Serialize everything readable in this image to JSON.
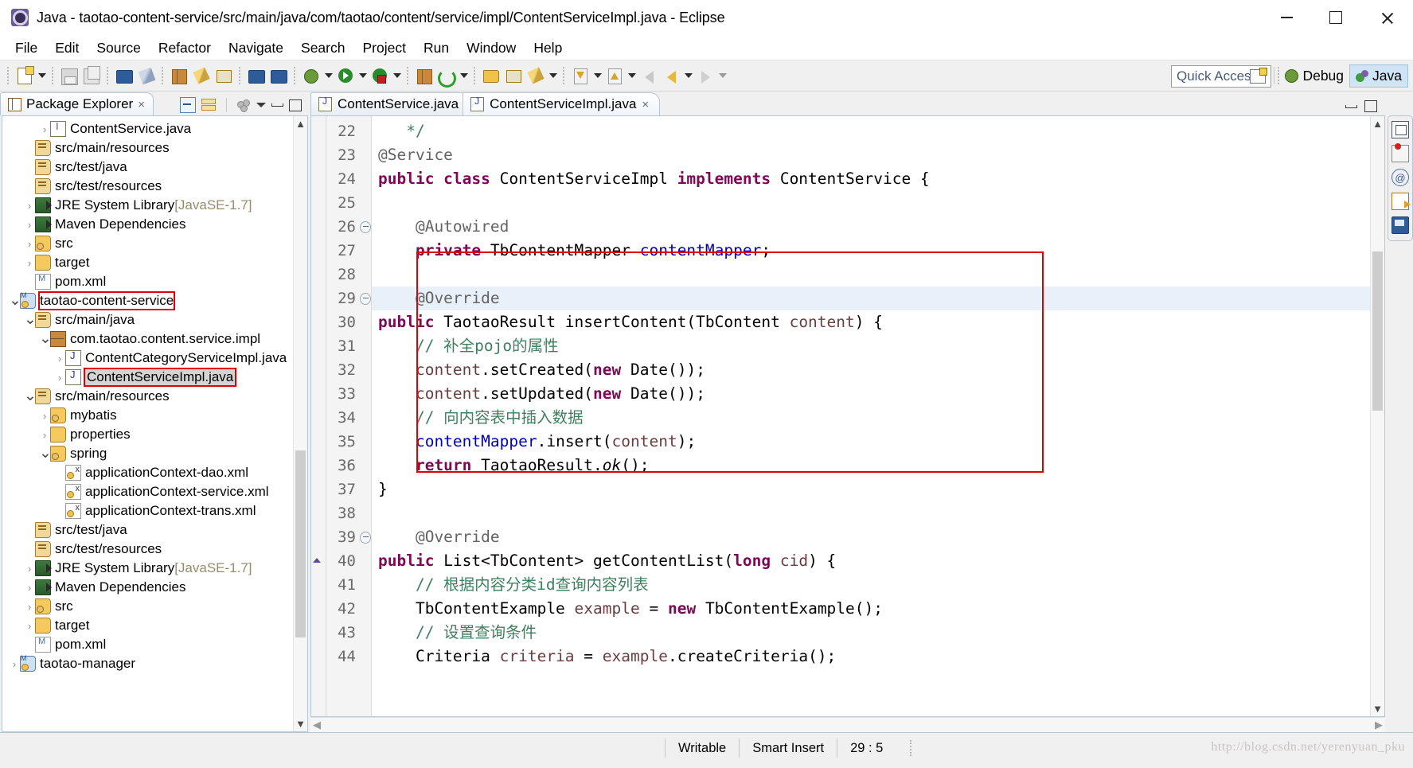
{
  "window": {
    "title": "Java - taotao-content-service/src/main/java/com/taotao/content/service/impl/ContentServiceImpl.java - Eclipse",
    "app_icon": "eclipse-icon",
    "controls": {
      "minimize": "minimize-button",
      "maximize": "maximize-button",
      "close": "close-button"
    }
  },
  "menubar": {
    "items": [
      "File",
      "Edit",
      "Source",
      "Refactor",
      "Navigate",
      "Search",
      "Project",
      "Run",
      "Window",
      "Help"
    ]
  },
  "toolbar": {
    "quick_access_placeholder": "Quick Access",
    "perspectives": [
      {
        "label": "Debug",
        "icon": "debug-perspective-icon",
        "active": false
      },
      {
        "label": "Java",
        "icon": "java-perspective-icon",
        "active": true
      }
    ],
    "open_perspective_icon": "open-perspective-icon"
  },
  "package_explorer": {
    "title": "Package Explorer",
    "tab_close": "×",
    "tools": [
      "collapse-all-icon",
      "link-with-editor-icon",
      "view-menu-icon",
      "minimize-icon",
      "maximize-icon"
    ],
    "tree": [
      {
        "indent": 2,
        "arrow": "closed",
        "icon": "java-interface-icon",
        "label": "ContentService.java"
      },
      {
        "indent": 1,
        "arrow": "none",
        "icon": "source-folder-icon",
        "label": "src/main/resources"
      },
      {
        "indent": 1,
        "arrow": "none",
        "icon": "source-folder-icon",
        "label": "src/test/java"
      },
      {
        "indent": 1,
        "arrow": "none",
        "icon": "source-folder-icon",
        "label": "src/test/resources"
      },
      {
        "indent": 1,
        "arrow": "closed",
        "icon": "library-icon",
        "label": "JRE System Library",
        "suffix": "[JavaSE-1.7]"
      },
      {
        "indent": 1,
        "arrow": "closed",
        "icon": "library-icon",
        "label": "Maven Dependencies"
      },
      {
        "indent": 1,
        "arrow": "closed",
        "icon": "folder-special-icon",
        "label": "src"
      },
      {
        "indent": 1,
        "arrow": "closed",
        "icon": "folder-icon",
        "label": "target"
      },
      {
        "indent": 1,
        "arrow": "none",
        "icon": "pom-icon",
        "label": "pom.xml"
      },
      {
        "indent": 0,
        "arrow": "open",
        "icon": "maven-project-icon",
        "label": "taotao-content-service",
        "highlight": true
      },
      {
        "indent": 1,
        "arrow": "open",
        "icon": "source-folder-icon",
        "label": "src/main/java"
      },
      {
        "indent": 2,
        "arrow": "open",
        "icon": "package-icon",
        "label": "com.taotao.content.service.impl"
      },
      {
        "indent": 3,
        "arrow": "closed",
        "icon": "java-class-icon",
        "label": "ContentCategoryServiceImpl.java"
      },
      {
        "indent": 3,
        "arrow": "closed",
        "icon": "java-class-icon",
        "label": "ContentServiceImpl.java",
        "selected": true,
        "highlight": true
      },
      {
        "indent": 1,
        "arrow": "open",
        "icon": "source-folder-icon",
        "label": "src/main/resources"
      },
      {
        "indent": 2,
        "arrow": "closed",
        "icon": "folder-special-icon",
        "label": "mybatis"
      },
      {
        "indent": 2,
        "arrow": "closed",
        "icon": "folder-icon",
        "label": "properties"
      },
      {
        "indent": 2,
        "arrow": "open",
        "icon": "folder-special-icon",
        "label": "spring"
      },
      {
        "indent": 3,
        "arrow": "none",
        "icon": "xml-file-icon",
        "label": "applicationContext-dao.xml"
      },
      {
        "indent": 3,
        "arrow": "none",
        "icon": "xml-file-icon",
        "label": "applicationContext-service.xml"
      },
      {
        "indent": 3,
        "arrow": "none",
        "icon": "xml-file-icon",
        "label": "applicationContext-trans.xml"
      },
      {
        "indent": 1,
        "arrow": "none",
        "icon": "source-folder-icon",
        "label": "src/test/java"
      },
      {
        "indent": 1,
        "arrow": "none",
        "icon": "source-folder-icon",
        "label": "src/test/resources"
      },
      {
        "indent": 1,
        "arrow": "closed",
        "icon": "library-icon",
        "label": "JRE System Library",
        "suffix": "[JavaSE-1.7]"
      },
      {
        "indent": 1,
        "arrow": "closed",
        "icon": "library-icon",
        "label": "Maven Dependencies"
      },
      {
        "indent": 1,
        "arrow": "closed",
        "icon": "folder-special-icon",
        "label": "src"
      },
      {
        "indent": 1,
        "arrow": "closed",
        "icon": "folder-icon",
        "label": "target"
      },
      {
        "indent": 1,
        "arrow": "none",
        "icon": "pom-icon",
        "label": "pom.xml"
      },
      {
        "indent": 0,
        "arrow": "closed",
        "icon": "maven-project-icon",
        "label": "taotao-manager"
      }
    ]
  },
  "editor": {
    "tabs": [
      {
        "label": "ContentService.java",
        "active": false,
        "closable": false
      },
      {
        "label": "ContentServiceImpl.java",
        "active": true,
        "closable": true,
        "close": "×"
      }
    ],
    "tools": [
      "minimize-icon",
      "maximize-icon"
    ],
    "first_visible_line": 22,
    "lines": [
      {
        "n": 22,
        "fold": "none",
        "marker": "none",
        "highlight": false,
        "tokens": [
          {
            "t": "   */",
            "c": "cm"
          }
        ]
      },
      {
        "n": 23,
        "fold": "none",
        "marker": "none",
        "highlight": false,
        "tokens": [
          {
            "t": "@Service",
            "c": "an"
          }
        ]
      },
      {
        "n": 24,
        "fold": "none",
        "marker": "none",
        "highlight": false,
        "tokens": [
          {
            "t": "public class ",
            "c": "kw"
          },
          {
            "t": "ContentServiceImpl ",
            "c": "plain"
          },
          {
            "t": "implements ",
            "c": "kw"
          },
          {
            "t": "ContentService {",
            "c": "plain"
          }
        ]
      },
      {
        "n": 25,
        "fold": "none",
        "marker": "none",
        "highlight": false,
        "tokens": []
      },
      {
        "n": 26,
        "fold": "collapse",
        "marker": "none",
        "highlight": false,
        "tokens": [
          {
            "t": "    @Autowired",
            "c": "an"
          }
        ]
      },
      {
        "n": 27,
        "fold": "none",
        "marker": "none",
        "highlight": false,
        "tokens": [
          {
            "t": "    private ",
            "c": "kw"
          },
          {
            "t": "TbContentMapper ",
            "c": "plain"
          },
          {
            "t": "contentMapper",
            "c": "fld"
          },
          {
            "t": ";",
            "c": "plain"
          }
        ]
      },
      {
        "n": 28,
        "fold": "none",
        "marker": "none",
        "highlight": false,
        "tokens": []
      },
      {
        "n": 29,
        "fold": "collapse",
        "marker": "none",
        "highlight": true,
        "tokens": [
          {
            "t": "    @Override",
            "c": "an"
          }
        ]
      },
      {
        "n": 30,
        "fold": "none",
        "marker": "none",
        "highlight": false,
        "tokens": [
          {
            "t": "public ",
            "c": "kw"
          },
          {
            "t": "TaotaoResult insertContent(TbContent ",
            "c": "plain"
          },
          {
            "t": "content",
            "c": "pm"
          },
          {
            "t": ") {",
            "c": "plain"
          }
        ]
      },
      {
        "n": 31,
        "fold": "none",
        "marker": "none",
        "highlight": false,
        "tokens": [
          {
            "t": "    // 补全pojo的属性",
            "c": "cm"
          }
        ]
      },
      {
        "n": 32,
        "fold": "none",
        "marker": "none",
        "highlight": false,
        "tokens": [
          {
            "t": "    ",
            "c": "plain"
          },
          {
            "t": "content",
            "c": "pm"
          },
          {
            "t": ".setCreated(",
            "c": "plain"
          },
          {
            "t": "new ",
            "c": "kw"
          },
          {
            "t": "Date());",
            "c": "plain"
          }
        ]
      },
      {
        "n": 33,
        "fold": "none",
        "marker": "none",
        "highlight": false,
        "tokens": [
          {
            "t": "    ",
            "c": "plain"
          },
          {
            "t": "content",
            "c": "pm"
          },
          {
            "t": ".setUpdated(",
            "c": "plain"
          },
          {
            "t": "new ",
            "c": "kw"
          },
          {
            "t": "Date());",
            "c": "plain"
          }
        ]
      },
      {
        "n": 34,
        "fold": "none",
        "marker": "none",
        "highlight": false,
        "tokens": [
          {
            "t": "    // 向内容表中插入数据",
            "c": "cm"
          }
        ]
      },
      {
        "n": 35,
        "fold": "none",
        "marker": "none",
        "highlight": false,
        "tokens": [
          {
            "t": "    ",
            "c": "plain"
          },
          {
            "t": "contentMapper",
            "c": "fld"
          },
          {
            "t": ".insert(",
            "c": "plain"
          },
          {
            "t": "content",
            "c": "pm"
          },
          {
            "t": ");",
            "c": "plain"
          }
        ]
      },
      {
        "n": 36,
        "fold": "none",
        "marker": "none",
        "highlight": false,
        "tokens": [
          {
            "t": "    return ",
            "c": "kw"
          },
          {
            "t": "TaotaoResult.",
            "c": "plain"
          },
          {
            "t": "ok",
            "c": "it"
          },
          {
            "t": "();",
            "c": "plain"
          }
        ]
      },
      {
        "n": 37,
        "fold": "none",
        "marker": "none",
        "highlight": false,
        "tokens": [
          {
            "t": "}",
            "c": "plain"
          }
        ]
      },
      {
        "n": 38,
        "fold": "none",
        "marker": "none",
        "highlight": false,
        "tokens": []
      },
      {
        "n": 39,
        "fold": "collapse",
        "marker": "none",
        "highlight": false,
        "tokens": [
          {
            "t": "    @Override",
            "c": "an"
          }
        ]
      },
      {
        "n": 40,
        "fold": "none",
        "marker": "override",
        "highlight": false,
        "tokens": [
          {
            "t": "public ",
            "c": "kw"
          },
          {
            "t": "List<TbContent> getContentList(",
            "c": "plain"
          },
          {
            "t": "long ",
            "c": "kw"
          },
          {
            "t": "cid",
            "c": "pm"
          },
          {
            "t": ") {",
            "c": "plain"
          }
        ]
      },
      {
        "n": 41,
        "fold": "none",
        "marker": "none",
        "highlight": false,
        "tokens": [
          {
            "t": "    // 根据内容分类id查询内容列表",
            "c": "cm"
          }
        ]
      },
      {
        "n": 42,
        "fold": "none",
        "marker": "none",
        "highlight": false,
        "tokens": [
          {
            "t": "    TbContentExample ",
            "c": "plain"
          },
          {
            "t": "example",
            "c": "pm"
          },
          {
            "t": " = ",
            "c": "plain"
          },
          {
            "t": "new ",
            "c": "kw"
          },
          {
            "t": "TbContentExample();",
            "c": "plain"
          }
        ]
      },
      {
        "n": 43,
        "fold": "none",
        "marker": "none",
        "highlight": false,
        "tokens": [
          {
            "t": "    // 设置查询条件",
            "c": "cm"
          }
        ]
      },
      {
        "n": 44,
        "fold": "none",
        "marker": "none",
        "highlight": false,
        "tokens": [
          {
            "t": "    Criteria ",
            "c": "plain"
          },
          {
            "t": "criteria",
            "c": "pm"
          },
          {
            "t": " = ",
            "c": "plain"
          },
          {
            "t": "example",
            "c": "pm"
          },
          {
            "t": ".createCriteria();",
            "c": "plain"
          }
        ]
      }
    ]
  },
  "right_icon_bar": {
    "icons": [
      "restore-icon",
      "outline-view-icon",
      "at-view-icon",
      "task-list-icon",
      "console-view-icon"
    ]
  },
  "statusbar": {
    "writable": "Writable",
    "insert_mode": "Smart Insert",
    "cursor_position": "29 : 5",
    "watermark": "http://blog.csdn.net/yerenyuan_pku"
  },
  "colors": {
    "keyword": "#7a0a55",
    "comment": "#3f7f5f",
    "annotation": "#646464",
    "field": "#0000c0",
    "parameter": "#6a3e3e",
    "highlight_box": "#e00000",
    "current_line": "#e8f0fa",
    "accent": "#cfe4f5"
  }
}
